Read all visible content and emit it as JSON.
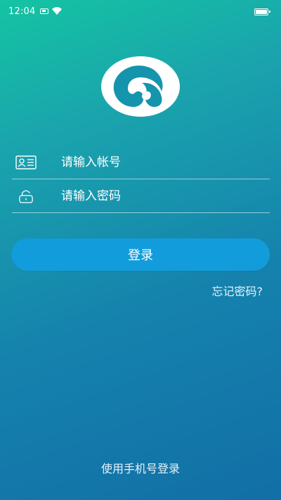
{
  "status_bar": {
    "time": "12:04",
    "icons": [
      "mute-icon",
      "wifi-icon",
      "battery-icon"
    ]
  },
  "logo": {
    "icon": "swirl-logo-icon"
  },
  "form": {
    "account": {
      "icon": "id-card-icon",
      "placeholder": "请输入帐号",
      "value": ""
    },
    "password": {
      "icon": "lock-icon",
      "placeholder": "请输入密码",
      "value": ""
    }
  },
  "actions": {
    "login_label": "登录",
    "forgot_label": "忘记密码?",
    "phone_login_label": "使用手机号登录"
  },
  "colors": {
    "gradient_start": "#14c4a2",
    "gradient_end": "#126fa6",
    "button": "#139cdb"
  }
}
